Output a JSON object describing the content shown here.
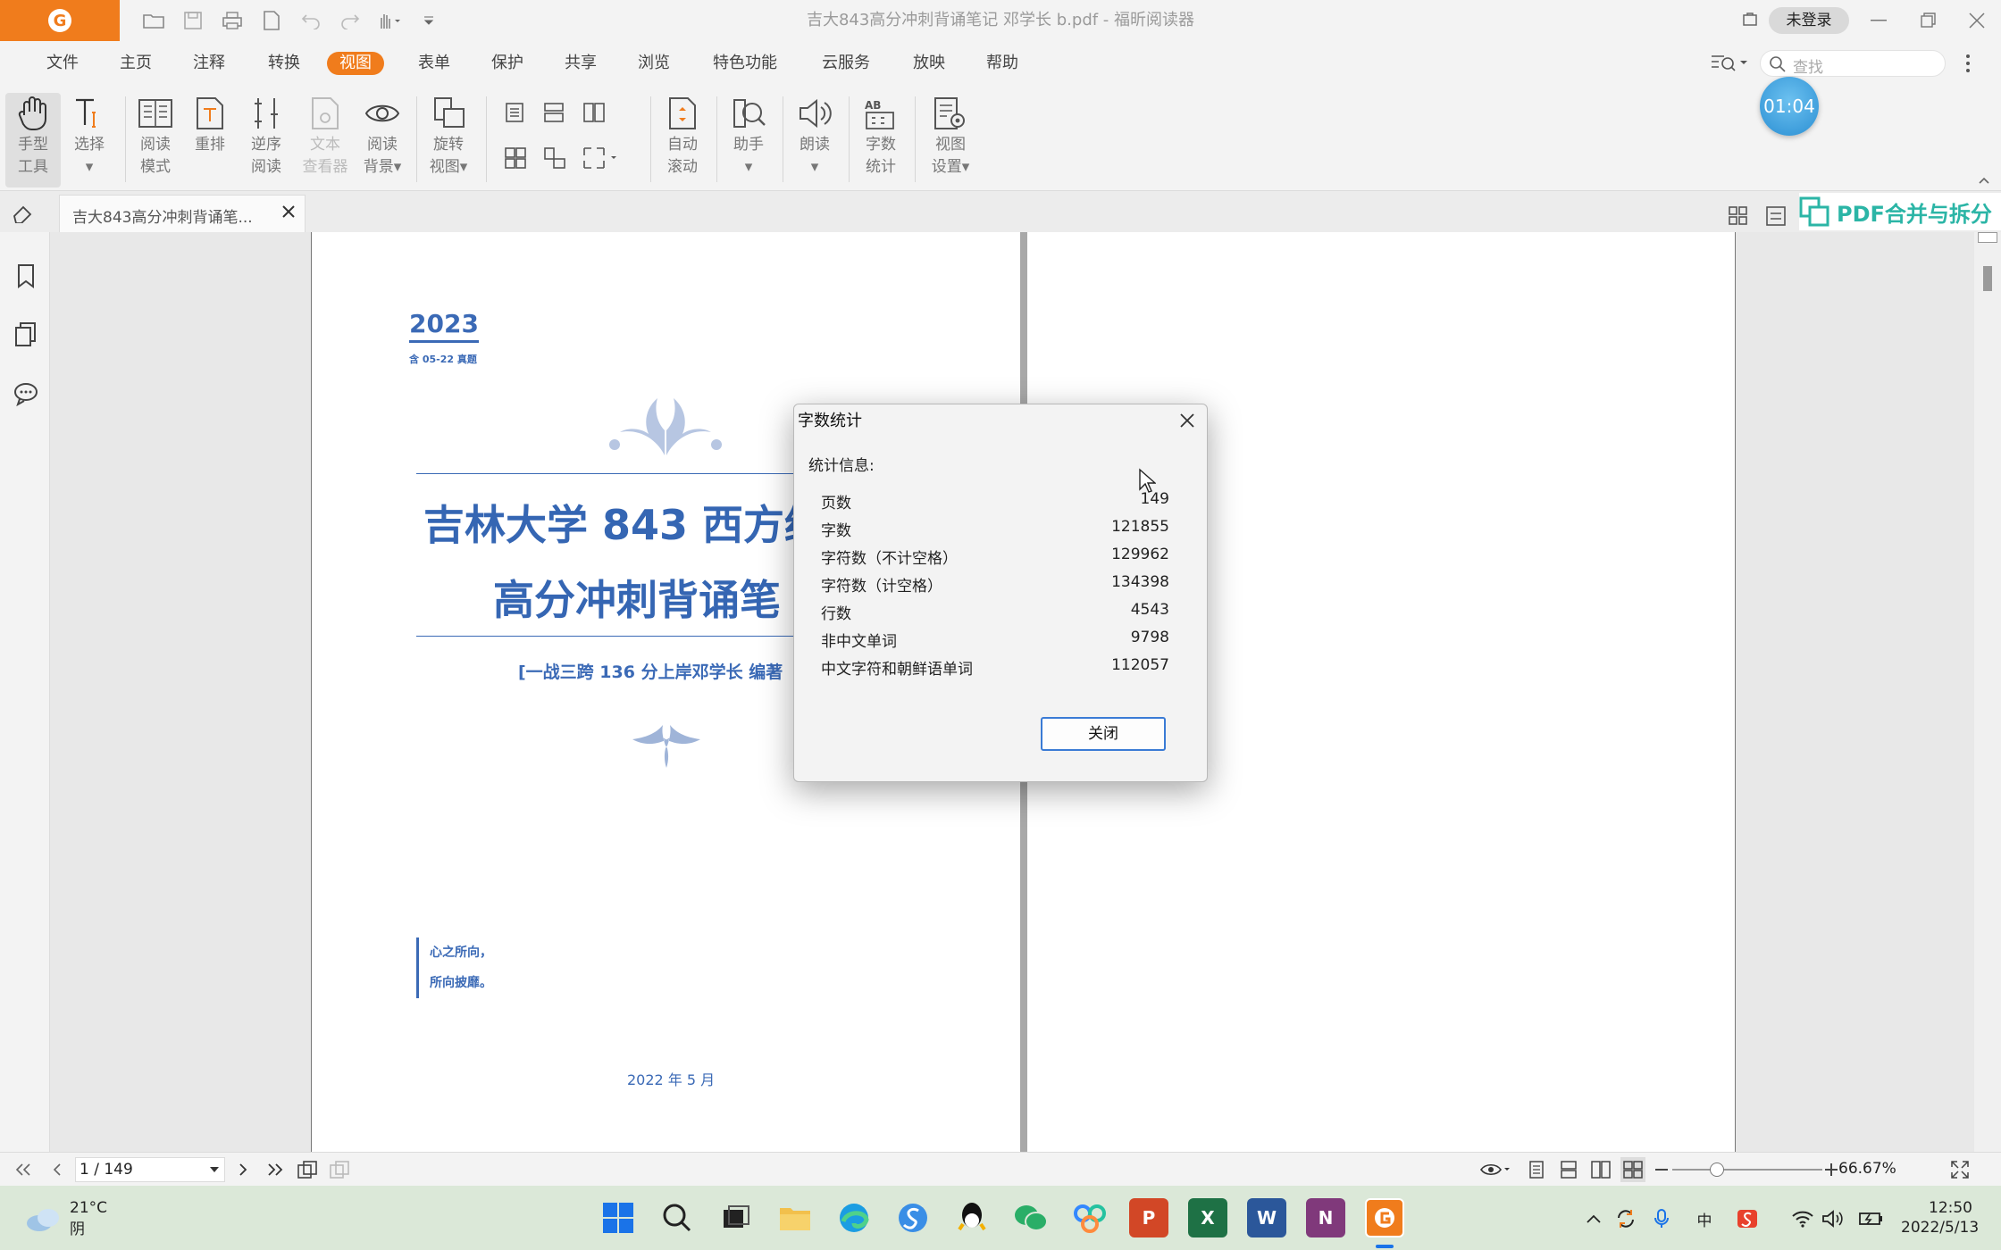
{
  "window": {
    "title": "吉大843高分冲刺背诵笔记 邓学长 b.pdf - 福昕阅读器",
    "login_label": "未登录"
  },
  "menu": [
    "文件",
    "主页",
    "注释",
    "转换",
    "视图",
    "表单",
    "保护",
    "共享",
    "浏览",
    "特色功能",
    "云服务",
    "放映",
    "帮助"
  ],
  "menu_active": "视图",
  "search": {
    "placeholder": "查找"
  },
  "ribbon": {
    "hand_tool": [
      "手型",
      "工具"
    ],
    "select": "选择",
    "read_mode": [
      "阅读",
      "模式"
    ],
    "reflow": "重排",
    "reverse_read": [
      "逆序",
      "阅读"
    ],
    "text_viewer": [
      "文本",
      "查看器"
    ],
    "read_bg": [
      "阅读",
      "背景"
    ],
    "rotate_view": [
      "旋转",
      "视图"
    ],
    "auto_scroll": [
      "自动",
      "滚动"
    ],
    "assistant": "助手",
    "read_aloud": "朗读",
    "word_count": [
      "字数",
      "统计"
    ],
    "view_settings": [
      "视图",
      "设置"
    ]
  },
  "timer": "01:04",
  "tab": {
    "label": "吉大843高分冲刺背诵笔..."
  },
  "banner": "PDF合并与拆分",
  "page": {
    "year": "2023",
    "sub": "含 05-22 真题",
    "title_line1": "吉林大学 843 西方经",
    "title_line2": "高分冲刺背诵笔",
    "author": "[一战三跨 136 分上岸邓学长 编著",
    "quote1": "心之所向，",
    "quote2": "所向披靡。",
    "date": "2022 年 5 月"
  },
  "dialog": {
    "title": "字数统计",
    "info_label": "统计信息:",
    "stats": [
      {
        "label": "页数",
        "value": "149"
      },
      {
        "label": "字数",
        "value": "121855"
      },
      {
        "label": "字符数（不计空格）",
        "value": "129962"
      },
      {
        "label": "字符数（计空格）",
        "value": "134398"
      },
      {
        "label": "行数",
        "value": "4543"
      },
      {
        "label": "非中文单词",
        "value": "9798"
      },
      {
        "label": "中文字符和朝鲜语单词",
        "value": "112057"
      }
    ],
    "close_button": "关闭"
  },
  "statusbar": {
    "page_indicator": "1 / 149",
    "zoom": "66.67%",
    "zoom_level": 0.3
  },
  "taskbar": {
    "temperature": "21°C",
    "weather": "阴",
    "time": "12:50",
    "date": "2022/5/13",
    "ime": "中"
  },
  "colors": {
    "accent": "#f07c1c",
    "doc_blue": "#3566b3",
    "dialog_button_border": "#3a7bd5",
    "banner": "#2bb5a6"
  }
}
